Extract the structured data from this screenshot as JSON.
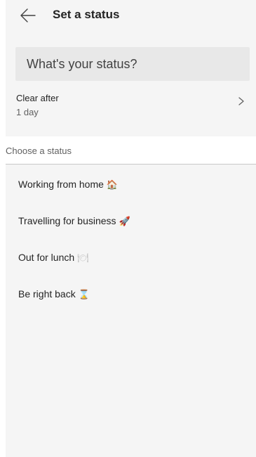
{
  "header": {
    "title": "Set a status",
    "back_icon": "back-arrow-icon"
  },
  "status_input": {
    "placeholder": "What's your status?",
    "value": ""
  },
  "clear_after": {
    "label": "Clear after",
    "value": "1 day",
    "icon": "chevron-right-icon"
  },
  "section": {
    "label": "Choose a status"
  },
  "statuses": [
    {
      "label": "Working from home",
      "emoji": "🏠"
    },
    {
      "label": "Travelling for business",
      "emoji": "🚀"
    },
    {
      "label": "Out for lunch",
      "emoji": "🍽"
    },
    {
      "label": "Be right back",
      "emoji": "⌛"
    }
  ],
  "colors": {
    "panel_bg": "#f5f5f5",
    "input_bg": "#e8e8e8",
    "section_bg": "#ffffff",
    "text_primary": "#242424",
    "text_secondary": "#616161"
  }
}
